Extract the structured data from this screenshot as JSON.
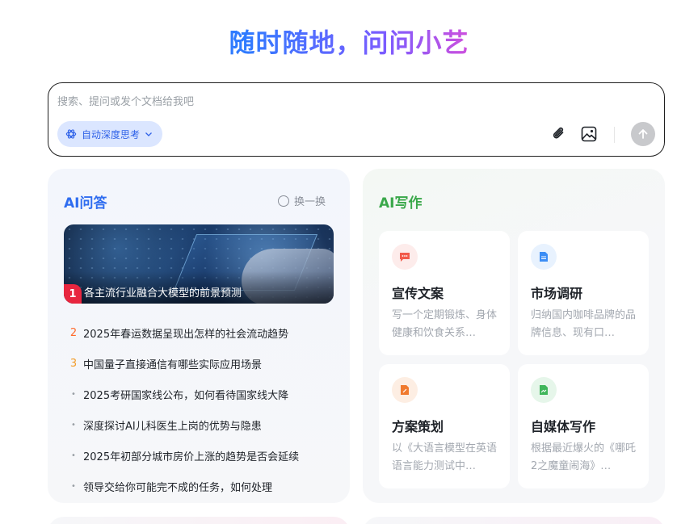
{
  "hero": {
    "title": "随时随地，问问小艺"
  },
  "search": {
    "placeholder": "搜索、提问或发个文档给我吧",
    "value": "",
    "think_mode_label": "自动深度思考",
    "icons": {
      "think": "sparkle-atom-icon",
      "attach": "paperclip-icon",
      "image": "image-icon",
      "send": "arrow-up-icon"
    }
  },
  "qa": {
    "title": "AI问答",
    "refresh_label": "换一换",
    "banner": {
      "rank": "1",
      "title": "各主流行业融合大模型的前景预测"
    },
    "items": [
      {
        "rank": "2",
        "text": "2025年春运数据呈现出怎样的社会流动趋势"
      },
      {
        "rank": "3",
        "text": "中国量子直接通信有哪些实际应用场景"
      },
      {
        "rank": "•",
        "text": "2025考研国家线公布，如何看待国家线大降"
      },
      {
        "rank": "•",
        "text": "深度探讨AI儿科医生上岗的优势与隐患"
      },
      {
        "rank": "•",
        "text": "2025年初部分城市房价上涨的趋势是否会延续"
      },
      {
        "rank": "•",
        "text": "领导交给你可能完不成的任务，如何处理"
      }
    ]
  },
  "writing": {
    "title": "AI写作",
    "items": [
      {
        "name": "宣传文案",
        "desc": "写一个定期锻炼、身体健康和饮食关系…",
        "icon": "chat-bubble-icon",
        "color": "#f25a4a",
        "bg": "#fdeceb"
      },
      {
        "name": "市场调研",
        "desc": "归纳国内咖啡品牌的品牌信息、现有口…",
        "icon": "document-icon",
        "color": "#3b8df5",
        "bg": "#e8f2fe"
      },
      {
        "name": "方案策划",
        "desc": "以《大语言模型在英语语言能力测试中…",
        "icon": "plan-document-icon",
        "color": "#f07a2e",
        "bg": "#fdeee3"
      },
      {
        "name": "自媒体写作",
        "desc": "根据最近爆火的《哪吒2之魔童闹海》…",
        "icon": "media-document-icon",
        "color": "#3fb65a",
        "bg": "#e6f6ea"
      }
    ]
  }
}
